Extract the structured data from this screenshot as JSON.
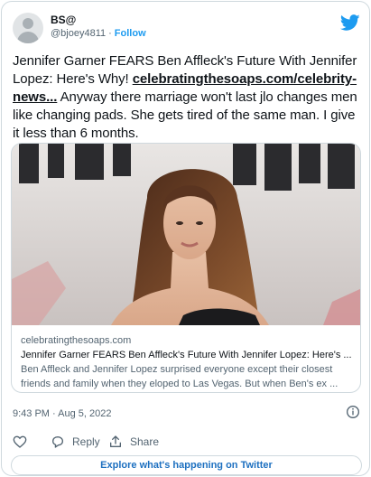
{
  "author": {
    "display_name": "BS@",
    "handle": "@bjoey4811",
    "separator": "·",
    "follow_label": "Follow"
  },
  "tweet": {
    "text_before_link": "Jennifer Garner FEARS Ben Affleck's Future With Jennifer Lopez: Here's Why! ",
    "link_text": "celebratingthesoaps.com/celebrity-news...",
    "text_after_link": " Anyway there marriage won't last jlo changes men like changing pads. She gets tired of the same man. I give it less than 6 months."
  },
  "card": {
    "domain": "celebratingthesoaps.com",
    "title": "Jennifer Garner FEARS Ben Affleck's Future With Jennifer Lopez: Here's ...",
    "description": "Ben Affleck and Jennifer Lopez surprised everyone except their closest friends and family when they eloped to Las Vegas. But when Ben's ex ..."
  },
  "timestamp": "9:43 PM · Aug 5, 2022",
  "actions": {
    "reply_label": "Reply",
    "share_label": "Share"
  },
  "explore_label": "Explore what's happening on Twitter",
  "colors": {
    "accent": "#1d9bf0",
    "explore_text": "#1d70c0",
    "secondary_text": "#536471",
    "border": "#cfd9de"
  },
  "icons": [
    "twitter-bird-icon",
    "info-icon",
    "heart-icon",
    "reply-icon",
    "share-icon"
  ]
}
